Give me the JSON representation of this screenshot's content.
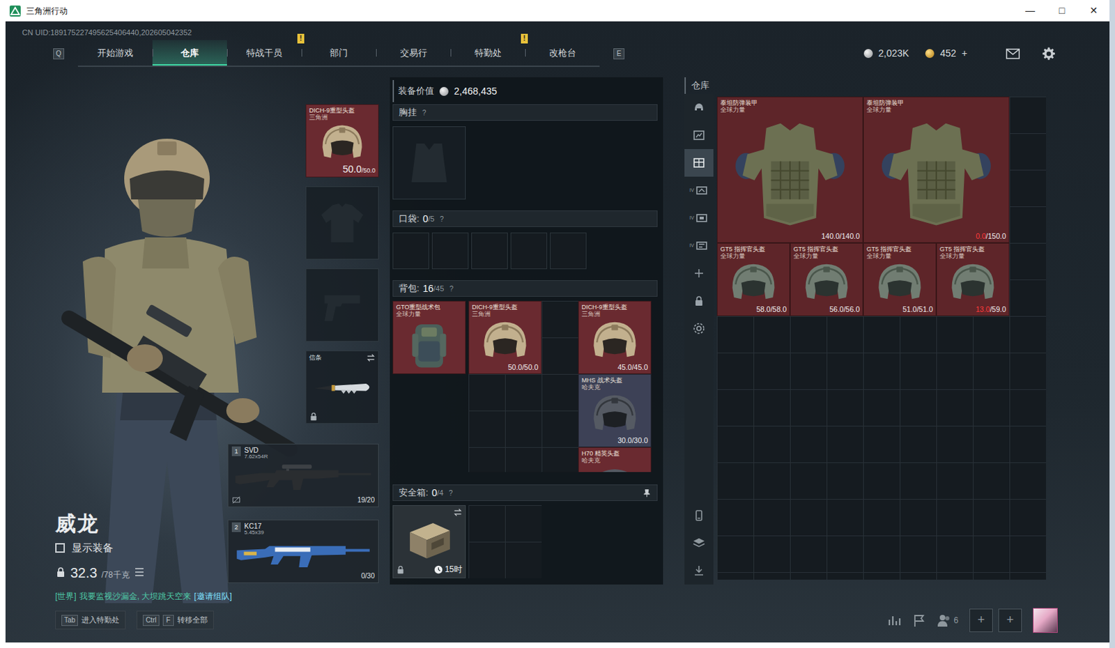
{
  "window": {
    "title": "三角洲行动",
    "controls": [
      "—",
      "□",
      "✕"
    ]
  },
  "uid": "CN UID:189175227495625406440,202605042352",
  "nav": {
    "prev_key": "Q",
    "next_key": "E",
    "tabs": [
      {
        "label": "开始游戏",
        "selected": false
      },
      {
        "label": "仓库",
        "selected": true
      },
      {
        "label": "特战干员",
        "selected": false,
        "badge": "!"
      },
      {
        "label": "部门",
        "selected": false
      },
      {
        "label": "交易行",
        "selected": false
      },
      {
        "label": "特勤处",
        "selected": false,
        "badge": "!"
      },
      {
        "label": "改枪台",
        "selected": false
      }
    ]
  },
  "currency": {
    "silver": "2,023K",
    "gold": "452",
    "gold_add": "+"
  },
  "operator": {
    "name": "威龙",
    "show_gear": {
      "label": "显示装备",
      "checked": false
    },
    "weight": {
      "current": "32.3",
      "max": "/78千克"
    }
  },
  "chat": {
    "channel": "[世界]",
    "message": "我要监视沙漏金, 大坝跳天空来",
    "action": "[邀请组队]"
  },
  "equipment": {
    "helmet": {
      "name": "DICH-9重型头盔",
      "brand": "三角洲",
      "current": "50.0",
      "max": "/50.0",
      "low": false,
      "color": "#6a2a30",
      "kind": "heavy-helmet"
    },
    "body_armor": {
      "equipped": false
    },
    "sidearm": {
      "equipped": false
    },
    "melee": {
      "name": "信条",
      "locked": true
    },
    "weapons": [
      {
        "slot": "1",
        "name": "SVD",
        "caliber": "7.62x54R",
        "ammo": "19/20",
        "kind": "marksman"
      },
      {
        "slot": "2",
        "name": "KC17",
        "caliber": "5.45x39",
        "ammo": "0/30",
        "kind": "assault"
      }
    ]
  },
  "loadout": {
    "value_label": "装备价值",
    "value": "2,468,435",
    "chest_rig": {
      "label": "胸挂",
      "help": "?",
      "equipped": false
    },
    "pockets": {
      "label": "口袋:",
      "count": "0",
      "capacity": "/5",
      "help": "?",
      "cells": 5
    },
    "backpack": {
      "label": "背包:",
      "count": "16",
      "capacity": "/45",
      "help": "?",
      "bag": {
        "name": "GTO重型战术包",
        "brand": "全球力量",
        "color": "#6a2a30",
        "kind": "bag"
      },
      "items": [
        {
          "name": "DICH-9重型头盔",
          "brand": "三角洲",
          "current": "50.0",
          "max": "/50.0",
          "low": false,
          "color": "#6a2a30",
          "kind": "heavy-helmet"
        },
        {
          "name": "DICH-9重型头盔",
          "brand": "三角洲",
          "current": "45.0",
          "max": "/45.0",
          "low": false,
          "color": "#6a2a30",
          "kind": "heavy-helmet"
        },
        {
          "name": "MHS 战术头盔",
          "brand": "哈夫克",
          "current": "30.0",
          "max": "/30.0",
          "low": false,
          "color": "#3d4156",
          "kind": "tactical-helmet"
        },
        {
          "name": "H70 精英头盔",
          "brand": "哈夫克",
          "color": "#6a2a30",
          "kind": "tactical-helmet"
        }
      ]
    },
    "safe_box": {
      "label": "安全箱:",
      "count": "0",
      "capacity": "/4",
      "help": "?",
      "timer": "15时",
      "locked": true
    }
  },
  "warehouse": {
    "title": "仓库",
    "sidebar": {
      "categories": [
        {
          "selected": false
        },
        {
          "selected": false
        },
        {
          "selected": true
        },
        {
          "selected": false,
          "tag": "IV"
        },
        {
          "selected": false,
          "tag": "IV"
        },
        {
          "selected": false,
          "tag": "IV"
        },
        {
          "selected": false
        },
        {
          "selected": false
        },
        {
          "selected": false
        }
      ],
      "tools": [
        {
          "selected": false
        },
        {
          "selected": false
        },
        {
          "selected": false
        }
      ]
    },
    "items": [
      {
        "name": "泰坦防弹装甲",
        "brand": "全球力量",
        "current": "140.0",
        "max": "/140.0",
        "low": false,
        "color": "#5e2529",
        "kind": "armor"
      },
      {
        "name": "泰坦防弹装甲",
        "brand": "全球力量",
        "current": "0.0",
        "max": "/150.0",
        "low": true,
        "color": "#5e2529",
        "kind": "armor"
      },
      {
        "name": "GT5 指挥官头盔",
        "brand": "全球力量",
        "current": "58.0",
        "max": "/58.0",
        "low": false,
        "color": "#5e2529",
        "kind": "commander-helmet"
      },
      {
        "name": "GT5 指挥官头盔",
        "brand": "全球力量",
        "current": "56.0",
        "max": "/56.0",
        "low": false,
        "color": "#5e2529",
        "kind": "commander-helmet"
      },
      {
        "name": "GT5 指挥官头盔",
        "brand": "全球力量",
        "current": "51.0",
        "max": "/51.0",
        "low": false,
        "color": "#5e2529",
        "kind": "commander-helmet"
      },
      {
        "name": "GT5 指挥官头盔",
        "brand": "全球力量",
        "current": "13.0",
        "max": "/59.0",
        "low": true,
        "color": "#5e2529",
        "kind": "commander-helmet"
      }
    ]
  },
  "bottom_bar": {
    "hints": [
      {
        "keys": [
          "Tab"
        ],
        "label": "进入特勤处"
      },
      {
        "keys": [
          "Ctrl",
          "F"
        ],
        "label": "转移全部"
      }
    ],
    "squad_count": "6",
    "squad_slots": [
      "+",
      "+"
    ]
  }
}
